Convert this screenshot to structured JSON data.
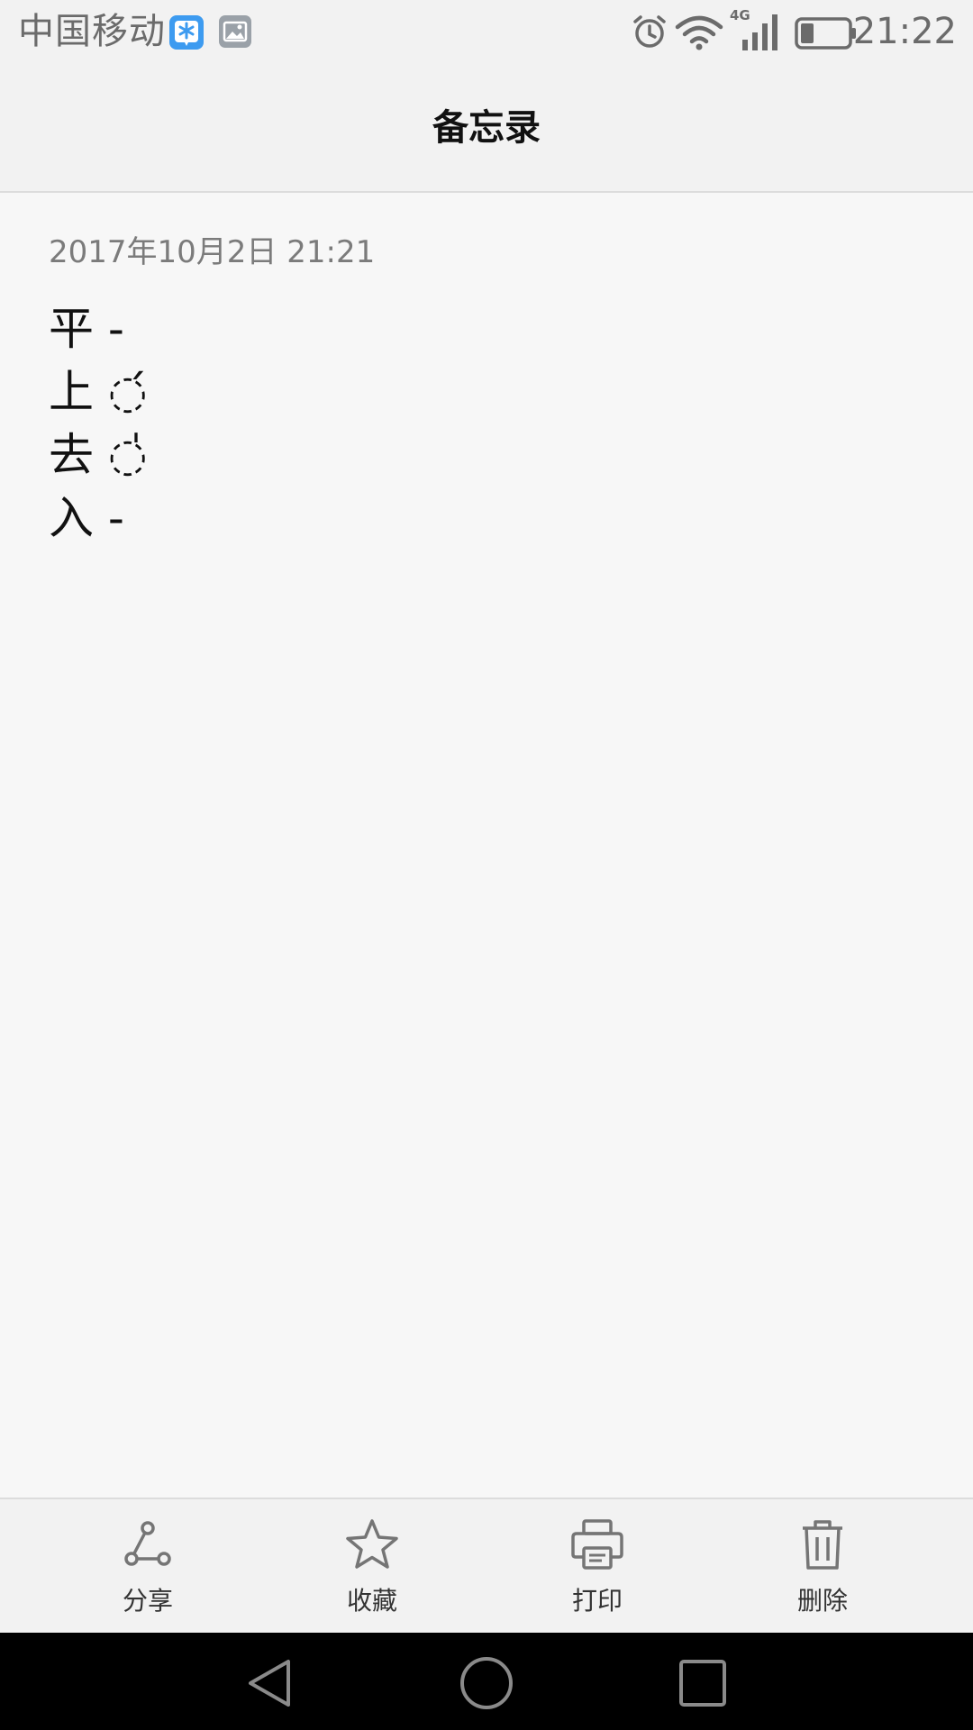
{
  "status_bar": {
    "carrier": "中国移动",
    "network_type": "4G",
    "time": "21:22"
  },
  "title_bar": {
    "title": "备忘录"
  },
  "note": {
    "date": "2017年10月2日 21:21",
    "lines": [
      "平 -",
      "上 ◌́",
      "去 ◌̍",
      "入 -"
    ]
  },
  "actions": [
    {
      "label": "分享",
      "icon": "share-icon"
    },
    {
      "label": "收藏",
      "icon": "star-icon"
    },
    {
      "label": "打印",
      "icon": "printer-icon"
    },
    {
      "label": "删除",
      "icon": "trash-icon"
    }
  ],
  "nav": {
    "back_icon": "back-triangle-icon",
    "home_icon": "home-circle-icon",
    "recents_icon": "recents-square-icon"
  },
  "colors": {
    "status_text": "#6b6b6b",
    "bar_bg": "#f2f2f2",
    "content_bg": "#f7f7f7",
    "icon_gray": "#757575",
    "notif_blue": "#3d9bf0"
  }
}
